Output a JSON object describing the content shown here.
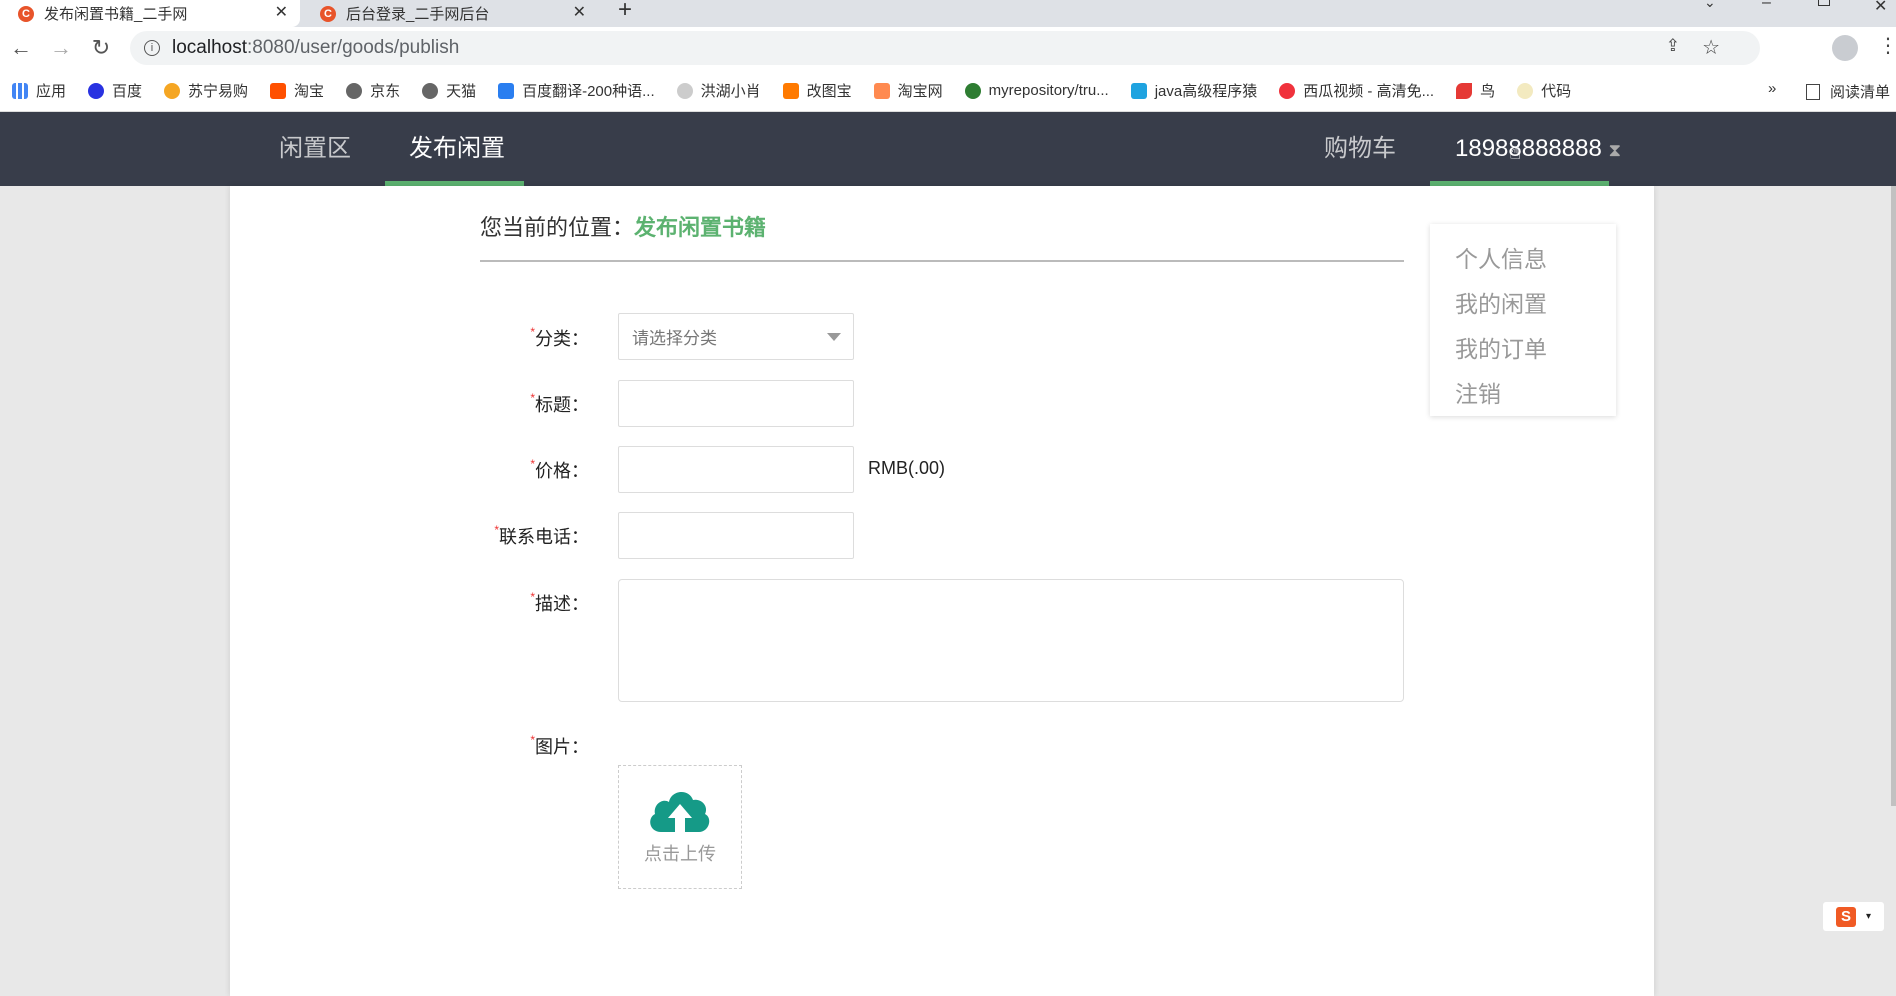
{
  "browser": {
    "tabs": [
      {
        "title": "发布闲置书籍_二手网",
        "active": true
      },
      {
        "title": "后台登录_二手网后台",
        "active": false
      }
    ],
    "new_tab": "+",
    "url_host": "localhost",
    "url_rest": ":8080/user/goods/publish",
    "bookmarks": [
      {
        "label": "应用",
        "color": "#4285f4"
      },
      {
        "label": "百度",
        "color": "#2932e1"
      },
      {
        "label": "苏宁易购",
        "color": "#f5a623"
      },
      {
        "label": "淘宝",
        "color": "#ff5000"
      },
      {
        "label": "京东",
        "color": "#666666"
      },
      {
        "label": "天猫",
        "color": "#666666"
      },
      {
        "label": "百度翻译-200种语...",
        "color": "#2a7ef0"
      },
      {
        "label": "洪湖小肖",
        "color": "#999999"
      },
      {
        "label": "改图宝",
        "color": "#ff7a00"
      },
      {
        "label": "淘宝网",
        "color": "#ff5000"
      },
      {
        "label": "myrepository/tru...",
        "color": "#2e7d32"
      },
      {
        "label": "java高级程序猿",
        "color": "#1fa3e0"
      },
      {
        "label": "西瓜视频 - 高清免...",
        "color": "#f0323c"
      },
      {
        "label": "鸟",
        "color": "#e53935"
      },
      {
        "label": "代码",
        "color": "#d8c56a"
      }
    ],
    "more_bookmarks": "»",
    "reading_list": "阅读清单"
  },
  "nav": {
    "items": [
      "闲置区",
      "发布闲置"
    ],
    "cart": "购物车",
    "user": "18988888888",
    "accent": "#5cb270"
  },
  "breadcrumb": {
    "prefix": "您当前的位置：",
    "current": "发布闲置书籍"
  },
  "form": {
    "required_mark": "*",
    "category_label": "分类：",
    "category_placeholder": "请选择分类",
    "title_label": "标题：",
    "price_label": "价格：",
    "price_unit": "RMB(.00)",
    "phone_label": "联系电话：",
    "desc_label": "描述：",
    "image_label": "图片：",
    "upload_text": "点击上传"
  },
  "user_menu": [
    "个人信息",
    "我的闲置",
    "我的订单",
    "注销"
  ]
}
